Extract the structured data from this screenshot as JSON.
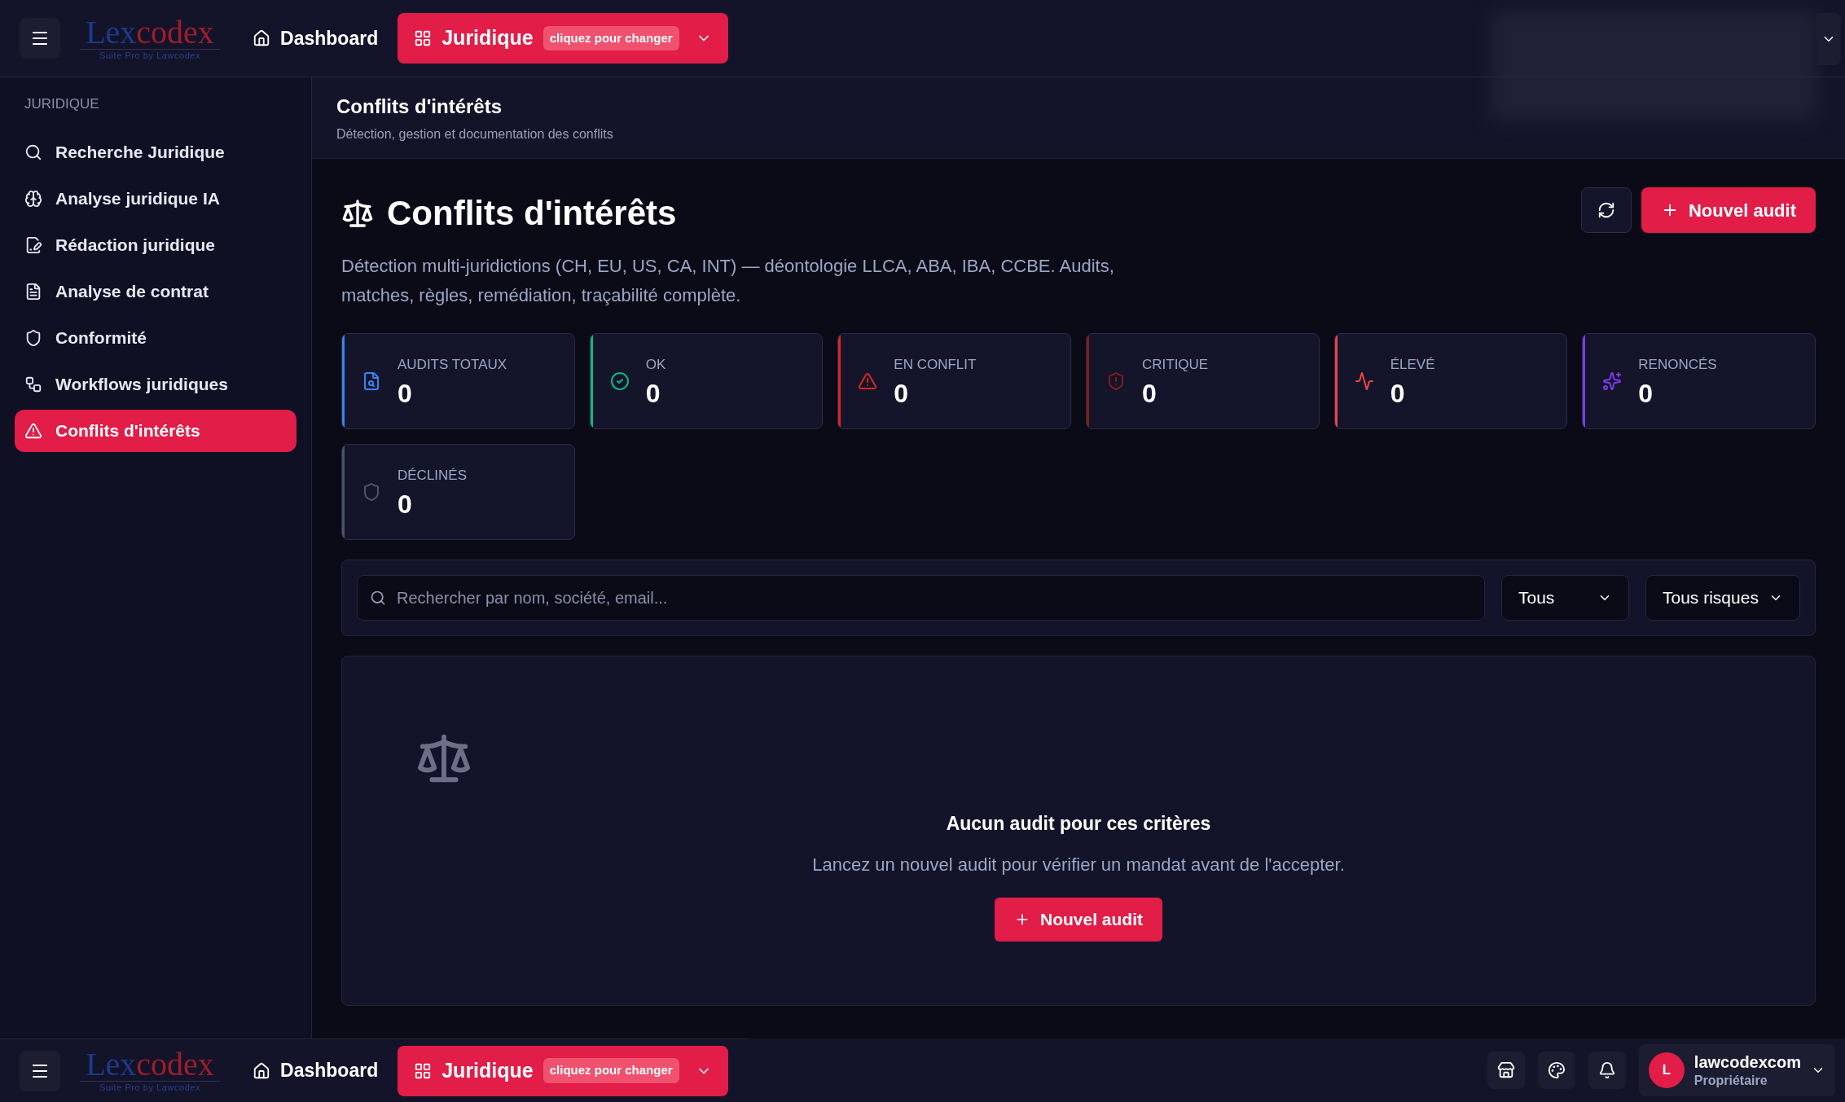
{
  "top_bar": {
    "logo": {
      "parts": [
        {
          "text": "Lex",
          "color": "#1e3a8a"
        },
        {
          "text": "codex",
          "color": "#9f1d2d"
        }
      ],
      "tagline": "Suite Pro by Lawcodex"
    },
    "dashboard": "Dashboard",
    "module": {
      "label": "Juridique",
      "hint": "cliquez pour changer"
    }
  },
  "sidebar": {
    "section": "JURIDIQUE",
    "items": [
      {
        "label": "Recherche Juridique",
        "selected": false
      },
      {
        "label": "Analyse juridique IA",
        "selected": false
      },
      {
        "label": "Rédaction juridique",
        "selected": false
      },
      {
        "label": "Analyse de contrat",
        "selected": false
      },
      {
        "label": "Conformité",
        "selected": false
      },
      {
        "label": "Workflows juridiques",
        "selected": false
      },
      {
        "label": "Conflits d'intérêts",
        "selected": true
      }
    ]
  },
  "header": {
    "title": "Conflits d'intérêts",
    "subtitle": "Détection, gestion et documentation des conflits"
  },
  "page": {
    "title": "Conflits d'intérêts",
    "description": "Détection multi-juridictions (CH, EU, US, CA, INT) — déontologie LLCA, ABA, IBA, CCBE. Audits, matches, règles, remédiation, traçabilité complète.",
    "new_audit": "Nouvel audit"
  },
  "stats": [
    {
      "label": "AUDITS TOTAUX",
      "value": "0",
      "color": "#3b82f6"
    },
    {
      "label": "OK",
      "value": "0",
      "color": "#10b981"
    },
    {
      "label": "EN CONFLIT",
      "value": "0",
      "color": "#dc2626"
    },
    {
      "label": "CRITIQUE",
      "value": "0",
      "color": "#7f1d1d"
    },
    {
      "label": "ÉLEVÉ",
      "value": "0",
      "color": "#ef4444"
    },
    {
      "label": "RENONCÉS",
      "value": "0",
      "color": "#7c3aed"
    },
    {
      "label": "DÉCLINÉS",
      "value": "0",
      "color": "#4b5563"
    }
  ],
  "filters": {
    "search": {
      "placeholder": "Rechercher par nom, société, email..."
    },
    "status": "Tous",
    "risk": "Tous risques"
  },
  "empty_state": {
    "title": "Aucun audit pour ces critères",
    "text": "Lancez un nouvel audit pour vérifier un mandat avant de l'accepter.",
    "button": "Nouvel audit"
  },
  "bottom_bar": {
    "logo": {
      "parts": [
        {
          "text": "Lex",
          "color": "#1e3a8a"
        },
        {
          "text": "codex",
          "color": "#9f1d2d"
        }
      ],
      "tagline": "Suite Pro by Lawcodex"
    },
    "dashboard": "Dashboard",
    "module": {
      "label": "Juridique",
      "hint": "cliquez pour changer"
    },
    "user": {
      "initial": "L",
      "name": "lawcodexcom",
      "role": "Propriétaire"
    }
  }
}
